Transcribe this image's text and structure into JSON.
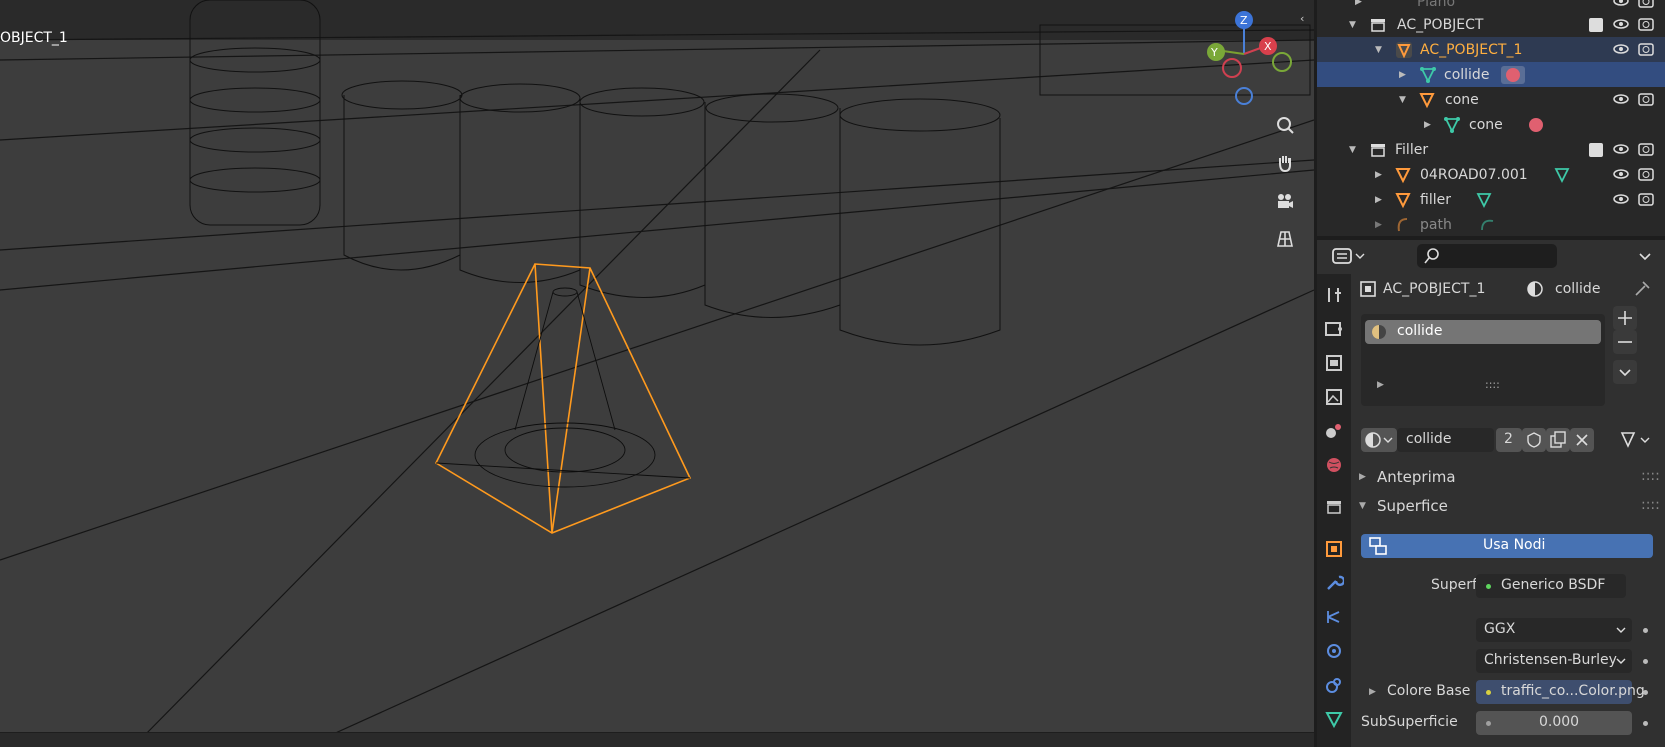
{
  "viewport": {
    "object_label": "OBJECT_1",
    "colors": {
      "selection": "#ff9a1e",
      "wire": "#0b0b0b",
      "background": "#3d3d3d"
    },
    "gizmo": {
      "z": "Z",
      "y": "Y",
      "x": "X"
    },
    "nav_icons": [
      "zoom-icon",
      "hand-pan-icon",
      "camera-icon",
      "grid-icon"
    ]
  },
  "outliner": {
    "rows": [
      {
        "label": "Piano",
        "icon": "mesh-object-icon"
      },
      {
        "label": "AC_POBJECT",
        "icon": "collection-icon"
      },
      {
        "label": "AC_POBJECT_1",
        "icon": "object-icon"
      },
      {
        "label": "collide",
        "icon": "mesh-data-icon"
      },
      {
        "label": "cone",
        "icon": "object-icon"
      },
      {
        "label": "cone",
        "icon": "mesh-data-icon"
      },
      {
        "label": "Filler",
        "icon": "collection-icon"
      },
      {
        "label": "04ROAD07.001",
        "icon": "object-icon"
      },
      {
        "label": "filler",
        "icon": "object-icon"
      },
      {
        "label": "path",
        "icon": "curve-icon"
      }
    ]
  },
  "properties": {
    "breadcrumb": {
      "object": "AC_POBJECT_1",
      "material": "collide"
    },
    "slots": [
      "collide"
    ],
    "material_name": "collide",
    "users": "2",
    "panels": {
      "preview": "Anteprima",
      "surface": "Superfice"
    },
    "use_nodes_label": "Usa Nodi",
    "surface_label": "Superfice",
    "surface_value": "Generico BSDF",
    "distribution": "GGX",
    "subsurface_method": "Christensen-Burley",
    "base_color_label": "Colore Base",
    "base_color_value": "traffic_co...Color.png",
    "subsurface_label": "SubSuperficie",
    "subsurface_value": "0.000"
  }
}
